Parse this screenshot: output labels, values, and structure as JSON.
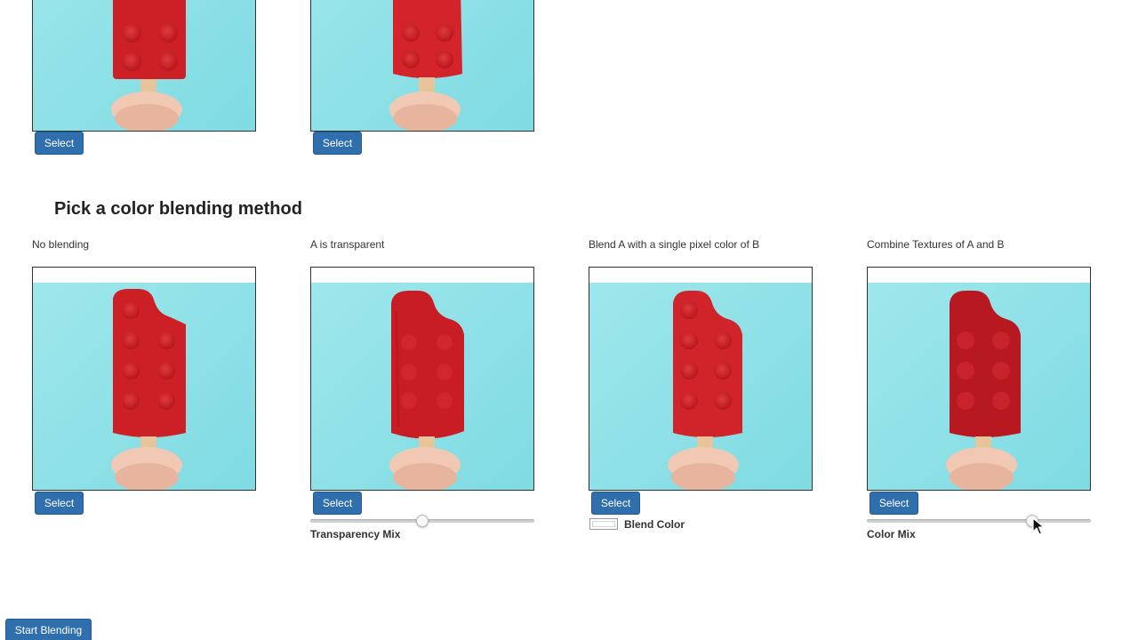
{
  "top_row": {
    "select_labels": [
      "Select",
      "Select"
    ]
  },
  "blending": {
    "title": "Pick a color blending method",
    "methods": [
      {
        "label": "No blending",
        "select_label": "Select"
      },
      {
        "label": "A is transparent",
        "select_label": "Select",
        "control_label": "Transparency Mix",
        "slider_value": 0.5
      },
      {
        "label": "Blend A with a single pixel color of B",
        "select_label": "Select",
        "control_label": "Blend Color",
        "color_value": "#ffffff"
      },
      {
        "label": "Combine Textures of A and B",
        "select_label": "Select",
        "control_label": "Color Mix",
        "slider_value": 0.74
      }
    ]
  },
  "start_button": "Start Blending",
  "colors": {
    "accent": "#2f6fad",
    "popsicle_red": "#cc1f26",
    "background_cyan": "#8fe0e6"
  }
}
